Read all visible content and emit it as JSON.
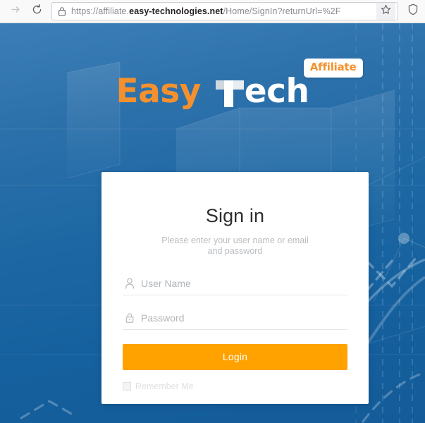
{
  "browser": {
    "forward_icon": "arrow-right-icon",
    "reload_icon": "reload-icon",
    "lock_icon": "padlock-icon",
    "bookmark_icon": "star-icon",
    "tracking_icon": "shield-icon",
    "url": {
      "prefix": "https://affiliate.",
      "host": "easy-technologies.net",
      "path": "/Home/SignIn?returnUrl=%2F",
      "full": "https://affiliate.easy-technologies.net/Home/SignIn?returnUrl=%2F"
    }
  },
  "brand": {
    "logo_part1": "Easy",
    "logo_letter": "T",
    "logo_part2": "ech",
    "badge_label": "Affiliate",
    "logo_orange": "#f4912e",
    "logo_white": "#ffffff"
  },
  "signin": {
    "title": "Sign in",
    "subtitle": "Please enter your user name or email and password",
    "username": {
      "icon": "user-icon",
      "placeholder": "User Name",
      "value": ""
    },
    "password": {
      "icon": "lock-icon",
      "placeholder": "Password",
      "value": ""
    },
    "login_label": "Login",
    "remember_label": "Remember Me",
    "remember_checked": false,
    "accent_color": "#ffa200"
  },
  "theme": {
    "bg_top": "#3c7fb8",
    "bg_bottom": "#145c99",
    "card_bg": "#ffffff"
  }
}
